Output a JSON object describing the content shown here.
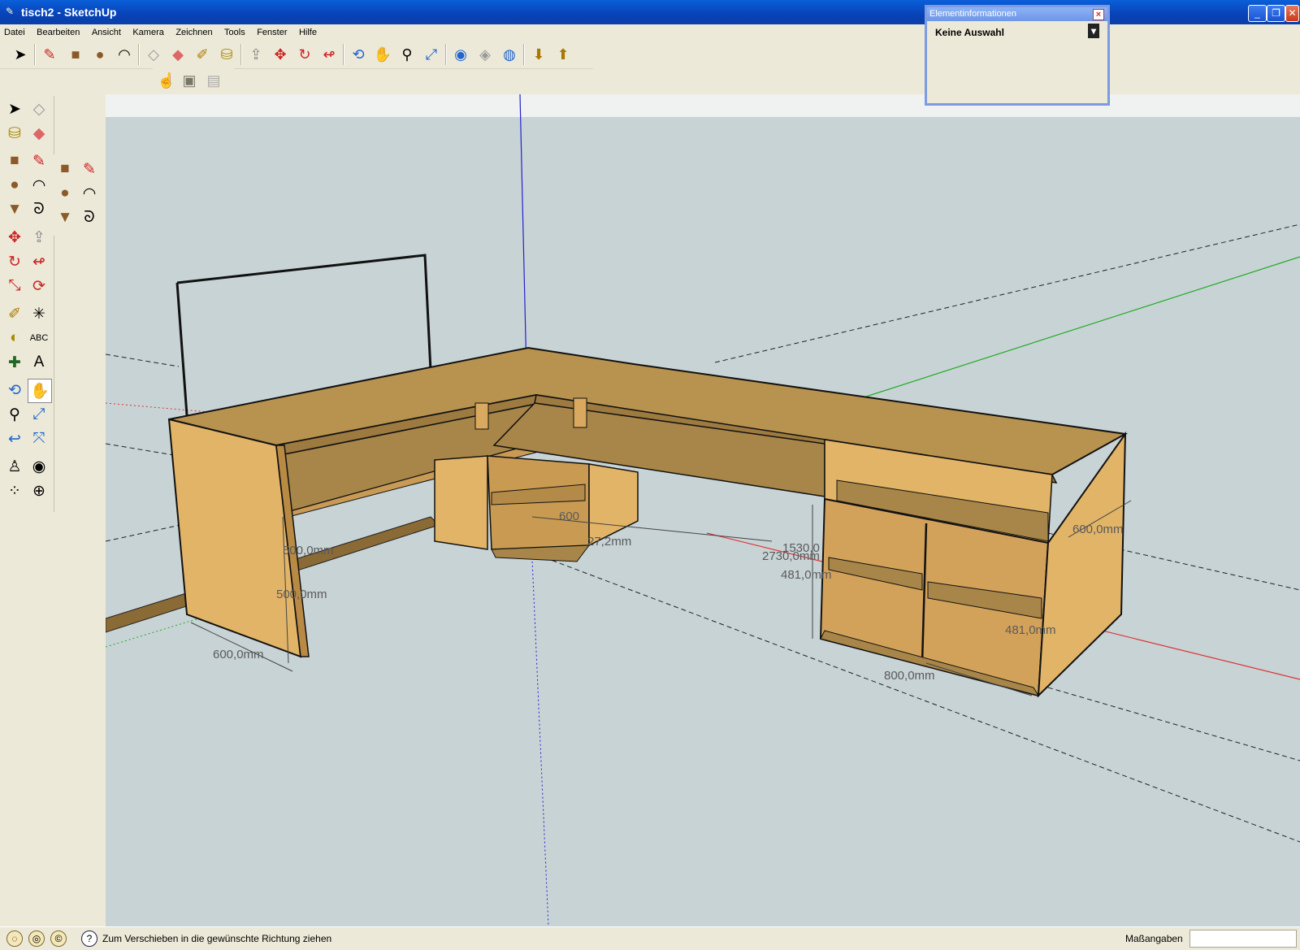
{
  "window": {
    "title": "tisch2 - SketchUp",
    "min": "_",
    "max": "❐",
    "close": "✕"
  },
  "menu": [
    "Datei",
    "Bearbeiten",
    "Ansicht",
    "Kamera",
    "Zeichnen",
    "Tools",
    "Fenster",
    "Hilfe"
  ],
  "entity_info": {
    "title": "Elementinformationen",
    "selection": "Keine Auswahl"
  },
  "status": {
    "hint": "Zum Verschieben in die gewünschte Richtung ziehen",
    "measurements_label": "Maßangaben",
    "measurements_value": ""
  },
  "dimensions": [
    "600,0mm",
    "500,0mm",
    "500,0mm",
    "600,0mm",
    "27,2mm",
    "1530,0",
    "2730,0mm",
    "481,0mm",
    "600,0mm",
    "481,0mm",
    "800,0mm",
    "600"
  ],
  "colors": {
    "wood": "#c9964a",
    "wood_light": "#e5b865",
    "wood_dark": "#9e7438",
    "sky": "#c8d3d6",
    "axis_red": "#d33",
    "axis_green": "#2a2",
    "axis_blue": "#22c"
  }
}
